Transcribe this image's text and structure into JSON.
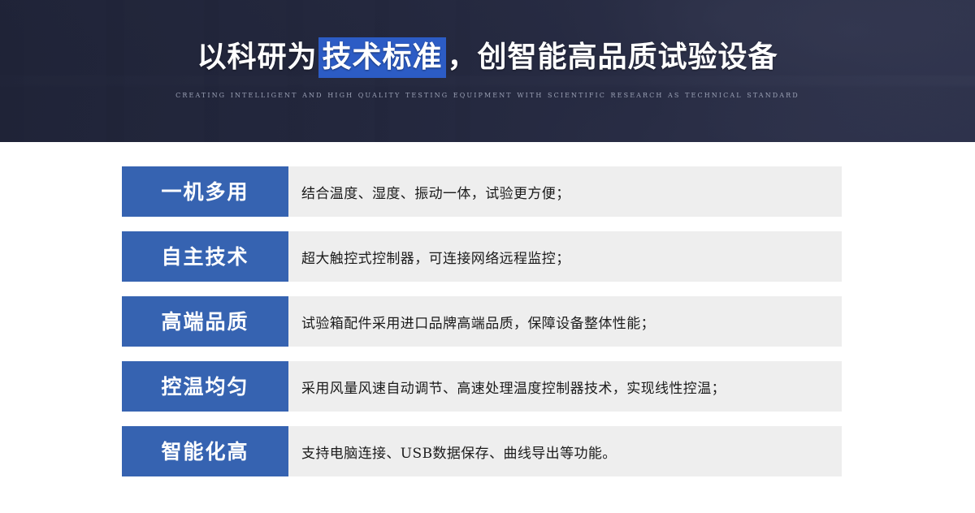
{
  "banner": {
    "title_before": "以科研为",
    "title_highlight": "技术标准",
    "title_after": "，创智能高品质试验设备",
    "subtitle": "Creating Intelligent and High Quality Testing Equipment with Scientific Research as Technical Standard",
    "highlight_color": "#2c5cc5",
    "background_color": "#262b42"
  },
  "features": {
    "tag_color": "#3663b1",
    "desc_background": "#eeeeee",
    "items": [
      {
        "tag": "一机多用",
        "desc": "结合温度、湿度、振动一体，试验更方便；"
      },
      {
        "tag": "自主技术",
        "desc": "超大触控式控制器，可连接网络远程监控；"
      },
      {
        "tag": "高端品质",
        "desc": "试验箱配件采用进口品牌高端品质，保障设备整体性能；"
      },
      {
        "tag": "控温均匀",
        "desc": "采用风量风速自动调节、高速处理温度控制器技术，实现线性控温；"
      },
      {
        "tag": "智能化高",
        "desc": "支持电脑连接、USB数据保存、曲线导出等功能。"
      }
    ]
  }
}
